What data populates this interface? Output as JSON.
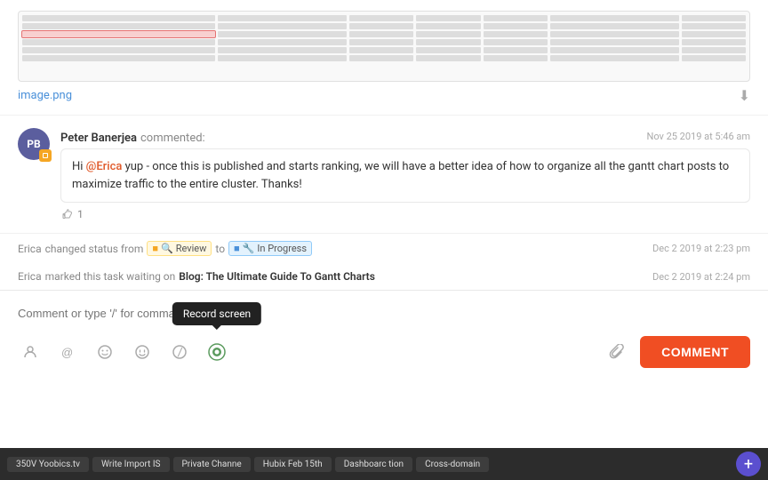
{
  "image": {
    "filename": "image.png",
    "download_label": "⬇"
  },
  "comment": {
    "author": "Peter Banerjea",
    "action": "commented:",
    "timestamp": "Nov 25 2019 at 5:46 am",
    "avatar_initials": "PB",
    "text_before_mention": "Hi ",
    "mention": "@Erica",
    "text_after_mention": " yup - once this is published and starts ranking, we will have a better idea of how to organize all the gantt chart posts to maximize traffic to the entire cluster. Thanks!",
    "like_count": "1"
  },
  "status_changes": [
    {
      "actor": "Erica",
      "action": "changed status from",
      "from_status": "Review",
      "to": "to",
      "to_status": "In Progress",
      "timestamp": "Dec 2 2019 at 2:23 pm"
    },
    {
      "actor": "Erica",
      "action": "marked this task waiting on",
      "link": "Blog: The Ultimate Guide To Gantt Charts",
      "timestamp": "Dec 2 2019 at 2:24 pm"
    }
  ],
  "comment_input": {
    "placeholder": "Comment or type '/' for commands"
  },
  "toolbar": {
    "tooltip": "Record screen",
    "comment_button": "COMMENT",
    "icons": [
      "person",
      "at",
      "emoji-happy",
      "smile",
      "slash",
      "record"
    ]
  },
  "taskbar": {
    "items": [
      "350V Yoobics.tv",
      "Write Import IS",
      "Private Channe",
      "Hubix Feb 15th",
      "Dashboarc tion",
      "Cross-domain"
    ]
  }
}
